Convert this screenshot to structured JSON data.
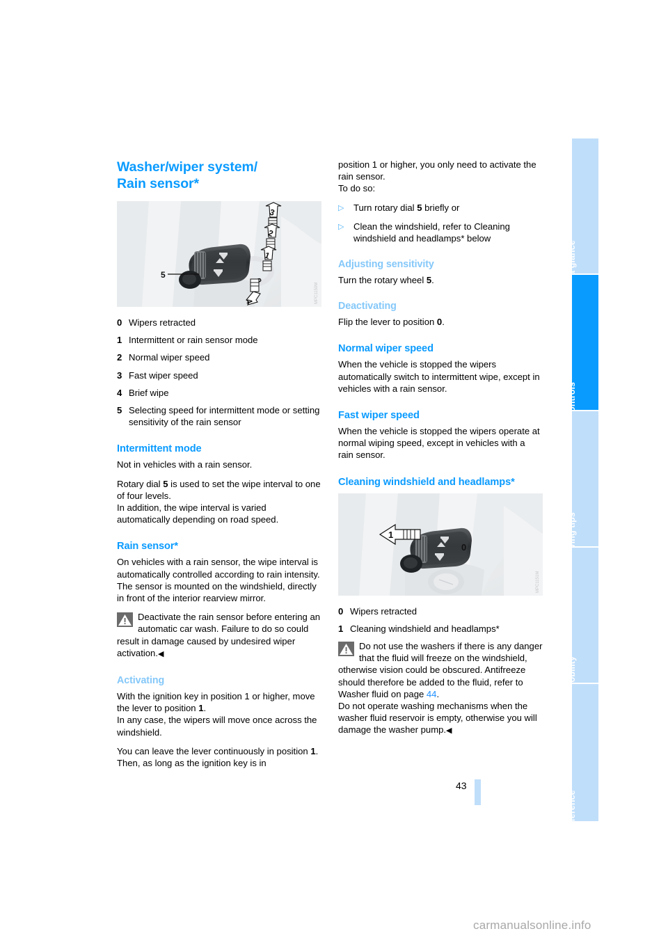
{
  "document": {
    "title": "Washer/wiper system/\nRain sensor*",
    "title_line1": "Washer/wiper system/",
    "title_line2": "Rain sensor*",
    "page_number": "43",
    "footer_watermark": "carmanualsonline.info"
  },
  "sidebar": {
    "tabs": [
      {
        "label": "At a glance",
        "active": false
      },
      {
        "label": "Controls",
        "active": true
      },
      {
        "label": "Driving tips",
        "active": false
      },
      {
        "label": "Mobility",
        "active": false
      },
      {
        "label": "Reference",
        "active": false
      }
    ]
  },
  "colors": {
    "heading_blue": "#0a9bff",
    "subheading_blue": "#85c8f9",
    "tab_inactive": "#bfdefa",
    "tab_active": "#0a9bff",
    "link_blue": "#1e90ff"
  },
  "figures": {
    "lever": {
      "caption_id": "wiper-stalk-positions",
      "callouts": [
        "0",
        "1",
        "2",
        "3",
        "4",
        "5"
      ],
      "watermark": "MPC1150M"
    },
    "washer": {
      "caption_id": "washer-lever-positions",
      "callouts": [
        "0",
        "1"
      ],
      "watermark": "MPC1151M"
    }
  },
  "left_column": {
    "legend": [
      {
        "num": "0",
        "text": "Wipers retracted"
      },
      {
        "num": "1",
        "text": "Intermittent or rain sensor mode"
      },
      {
        "num": "2",
        "text": "Normal wiper speed"
      },
      {
        "num": "3",
        "text": "Fast wiper speed"
      },
      {
        "num": "4",
        "text": "Brief wipe"
      },
      {
        "num": "5",
        "text": "Selecting speed for intermittent mode or setting sensitivity of the rain sensor"
      }
    ],
    "intermittent": {
      "heading": "Intermittent mode",
      "p1": "Not in vehicles with a rain sensor.",
      "p2_a": "Rotary dial ",
      "p2_b": "5",
      "p2_c": " is used to set the wipe interval to one of four levels.",
      "p3": "In addition, the wipe interval is varied automatically depending on road speed."
    },
    "rain_sensor": {
      "heading": "Rain sensor*",
      "p1": "On vehicles with a rain sensor, the wipe interval is automatically controlled according to rain intensity. The sensor is mounted on the windshield, directly in front of the interior rearview mirror.",
      "warning": "Deactivate the rain sensor before entering an automatic car wash. Failure to do so could result in damage caused by undesired wiper activation.",
      "warning_end": "◀"
    },
    "activating": {
      "heading": "Activating",
      "p1_a": "With the ignition key in position 1 or higher, move the lever to position ",
      "p1_b": "1",
      "p1_c": ".",
      "p2": "In any case, the wipers will move once across the windshield.",
      "p3_a": "You can leave the lever continuously in position ",
      "p3_b": "1",
      "p3_c": ". Then, as long as the ignition key is in"
    }
  },
  "right_column": {
    "continuation": {
      "p1": "position 1 or higher, you only need to activate the rain sensor.",
      "p2": "To do so:"
    },
    "bullets": [
      {
        "marker": "▷",
        "text_a": "Turn rotary dial ",
        "text_b": "5",
        "text_c": " briefly or"
      },
      {
        "marker": "▷",
        "text_a": "Clean the windshield, refer to Cleaning windshield and headlamps* below",
        "text_b": "",
        "text_c": ""
      }
    ],
    "adjusting": {
      "heading": "Adjusting sensitivity",
      "p1_a": "Turn the rotary wheel ",
      "p1_b": "5",
      "p1_c": "."
    },
    "deactivating": {
      "heading": "Deactivating",
      "p1_a": "Flip the lever to position ",
      "p1_b": "0",
      "p1_c": "."
    },
    "normal_speed": {
      "heading": "Normal wiper speed",
      "p1": "When the vehicle is stopped the wipers automatically switch to intermittent wipe, except in vehicles with a rain sensor."
    },
    "fast_speed": {
      "heading": "Fast wiper speed",
      "p1": "When the vehicle is stopped the wipers operate at normal wiping speed, except in vehicles with a rain sensor."
    },
    "cleaning": {
      "heading": "Cleaning windshield and headlamps*",
      "legend": [
        {
          "num": "0",
          "text": "Wipers retracted"
        },
        {
          "num": "1",
          "text": "Cleaning windshield and headlamps*"
        }
      ],
      "warning_a": "Do not use the washers if there is any danger that the fluid will freeze on the windshield, otherwise vision could be obscured. Antifreeze should therefore be added to the fluid, refer to Washer fluid on page ",
      "warning_page": "44",
      "warning_b": ".",
      "warning_c": "Do not operate washing mechanisms when the washer fluid reservoir is empty, otherwise you will damage the washer pump.",
      "warning_end": "◀"
    }
  }
}
